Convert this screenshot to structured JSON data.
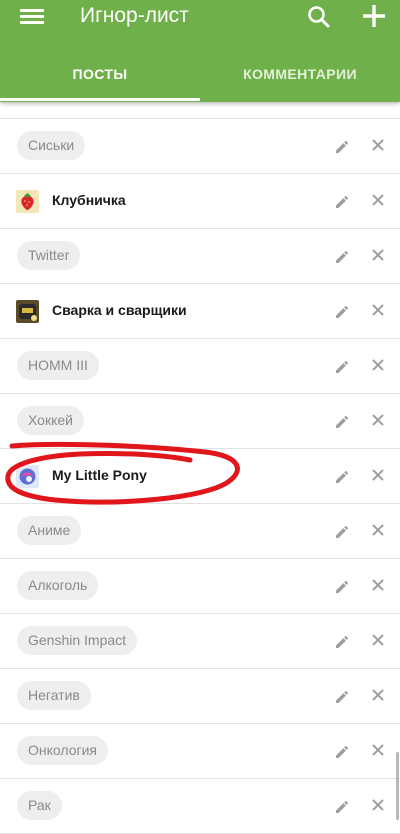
{
  "appbar": {
    "title": "Игнор-лист",
    "icons": [
      "menu-icon",
      "search-icon",
      "plus-icon"
    ],
    "color": "#6fb04a"
  },
  "tabs": [
    {
      "label": "ПОСТЫ",
      "active": true
    },
    {
      "label": "КОММЕНТАРИИ",
      "active": false
    }
  ],
  "list": {
    "items": [
      {
        "label": "",
        "type": "partial"
      },
      {
        "label": "Сиськи",
        "type": "tag"
      },
      {
        "label": "Клубничка",
        "type": "community",
        "avatar": "strawberry-avatar-icon"
      },
      {
        "label": "Twitter",
        "type": "tag"
      },
      {
        "label": "Сварка и сварщики",
        "type": "community",
        "avatar": "welder-avatar-icon"
      },
      {
        "label": "HOMM III",
        "type": "tag"
      },
      {
        "label": "Хоккей",
        "type": "tag"
      },
      {
        "label": "My Little Pony",
        "type": "community",
        "avatar": "pony-avatar-icon"
      },
      {
        "label": "Аниме",
        "type": "tag"
      },
      {
        "label": "Алкоголь",
        "type": "tag"
      },
      {
        "label": "Genshin Impact",
        "type": "tag"
      },
      {
        "label": "Негатив",
        "type": "tag"
      },
      {
        "label": "Онкология",
        "type": "tag"
      },
      {
        "label": "Рак",
        "type": "tag"
      }
    ],
    "row_icons": [
      "pencil-icon",
      "close-icon"
    ]
  },
  "annotation": {
    "color": "#e0161b"
  }
}
